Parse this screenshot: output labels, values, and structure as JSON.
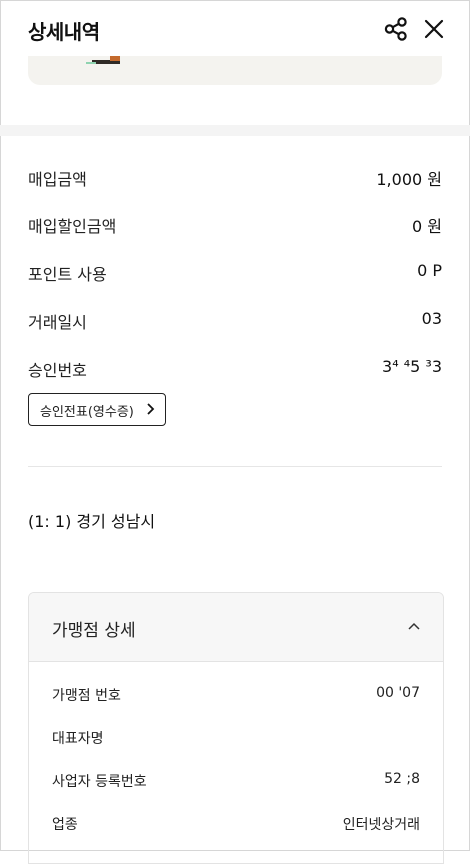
{
  "header": {
    "title": "상세내역",
    "share_icon": "share-icon",
    "close_icon": "close-icon"
  },
  "details": {
    "purchase_amount": {
      "label": "매입금액",
      "value": "1,000 원"
    },
    "purchase_discount": {
      "label": "매입할인금액",
      "value": "0 원"
    },
    "points_used": {
      "label": "포인트 사용",
      "value": "0 P"
    },
    "transaction_datetime": {
      "label": "거래일시",
      "value": "03"
    },
    "approval_number": {
      "label": "승인번호",
      "value": "3⁴  ⁴5  ³3"
    }
  },
  "receipt_button": {
    "label": "승인전표(영수증)"
  },
  "address": "(1:        1) 경기 성남시",
  "merchant": {
    "title": "가맹점 상세",
    "rows": [
      {
        "label": "가맹점 번호",
        "value": "00              '07"
      },
      {
        "label": "대표자명",
        "value": ""
      },
      {
        "label": "사업자 등록번호",
        "value": "52            ;8"
      },
      {
        "label": "업종",
        "value": "인터넷상거래"
      }
    ]
  },
  "colors": {
    "background": "#ffffff",
    "band": "#f4f4f4",
    "banner": "#f4f3ef",
    "text": "#111111",
    "card_header": "#f7f7f7"
  }
}
